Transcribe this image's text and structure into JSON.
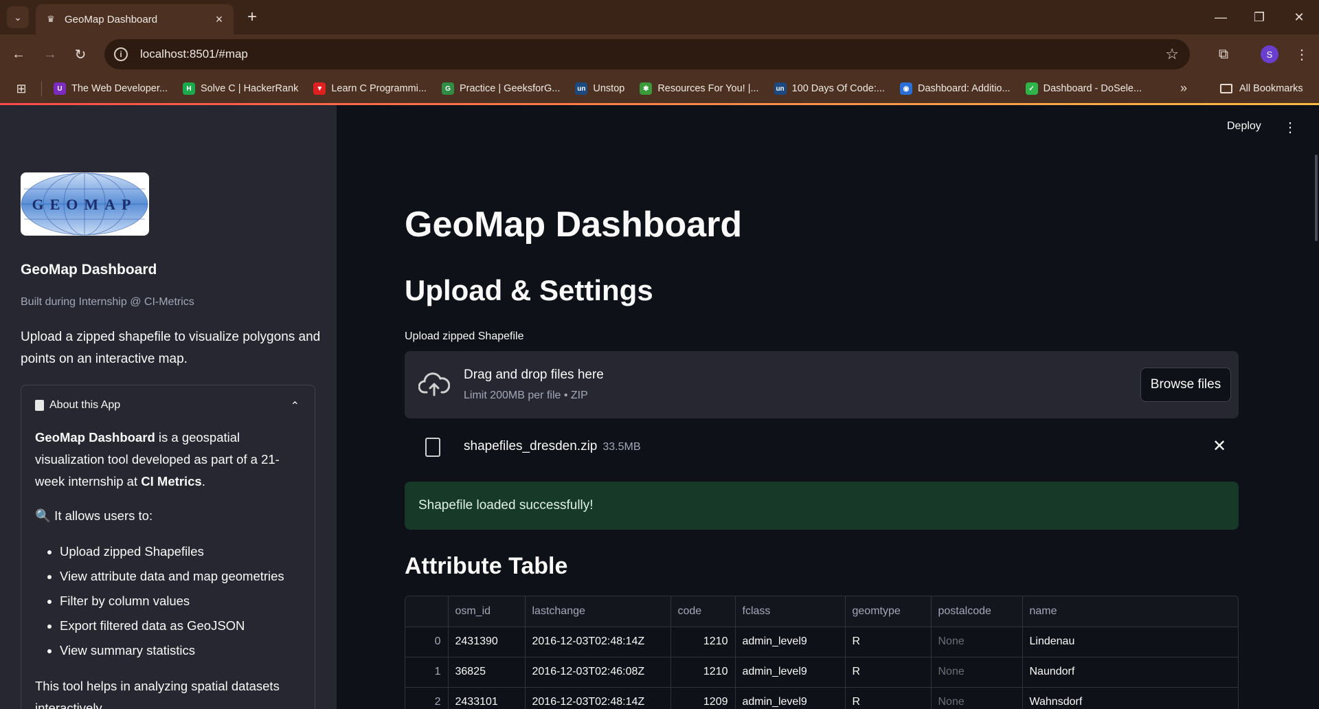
{
  "browser": {
    "tab_title": "GeoMap Dashboard",
    "url": "localhost:8501/#map",
    "profile_initial": "S",
    "bookmarks": [
      {
        "label": "The Web Developer...",
        "icon_color": "#7b2cbf",
        "icon_text": "U"
      },
      {
        "label": "Solve C | HackerRank",
        "icon_color": "#1ba94c",
        "icon_text": "H"
      },
      {
        "label": "Learn C Programmi...",
        "icon_color": "#e02020",
        "icon_text": "▼"
      },
      {
        "label": "Practice | GeeksforG...",
        "icon_color": "#2f8d46",
        "icon_text": "G"
      },
      {
        "label": "Unstop",
        "icon_color": "#1c4980",
        "icon_text": "un"
      },
      {
        "label": "Resources For You! |...",
        "icon_color": "#3a9a3a",
        "icon_text": "✱"
      },
      {
        "label": "100 Days Of Code:...",
        "icon_color": "#1c4980",
        "icon_text": "un"
      },
      {
        "label": "Dashboard: Additio...",
        "icon_color": "#2a6fd6",
        "icon_text": "◉"
      },
      {
        "label": "Dashboard - DoSele...",
        "icon_color": "#2fb44a",
        "icon_text": "✓"
      }
    ],
    "all_bookmarks": "All Bookmarks"
  },
  "sidebar": {
    "logo_text": "GEOMAP",
    "title": "GeoMap Dashboard",
    "caption": "Built during Internship @ CI-Metrics",
    "description": "Upload a zipped shapefile to visualize polygons and points on an interactive map.",
    "expander": {
      "title": "About this App",
      "intro_bold": "GeoMap Dashboard",
      "intro_rest": " is a geospatial visualization tool developed as part of a 21-week internship at ",
      "intro_org": "CI Metrics",
      "intro_end": ".",
      "allows": "🔍 It allows users to:",
      "features": [
        "Upload zipped Shapefiles",
        "View attribute data and map geometries",
        "Filter by column values",
        "Export filtered data as GeoJSON",
        "View summary statistics"
      ],
      "closing": "This tool helps in analyzing spatial datasets interactively."
    }
  },
  "main": {
    "deploy": "Deploy",
    "title": "GeoMap Dashboard",
    "section_upload": "Upload & Settings",
    "upload_label": "Upload zipped Shapefile",
    "dropzone_title": "Drag and drop files here",
    "dropzone_sub": "Limit 200MB per file • ZIP",
    "browse": "Browse files",
    "file_name": "shapefiles_dresden.zip",
    "file_size": "33.5MB",
    "success": "Shapefile loaded successfully!",
    "section_table": "Attribute Table",
    "table": {
      "columns": [
        "",
        "osm_id",
        "lastchange",
        "code",
        "fclass",
        "geomtype",
        "postalcode",
        "name"
      ],
      "rows": [
        [
          "0",
          "2431390",
          "2016-12-03T02:48:14Z",
          "1210",
          "admin_level9",
          "R",
          "None",
          "Lindenau"
        ],
        [
          "1",
          "36825",
          "2016-12-03T02:46:08Z",
          "1210",
          "admin_level9",
          "R",
          "None",
          "Naundorf"
        ],
        [
          "2",
          "2433101",
          "2016-12-03T02:48:14Z",
          "1209",
          "admin_level9",
          "R",
          "None",
          "Wahnsdorf"
        ]
      ]
    }
  }
}
